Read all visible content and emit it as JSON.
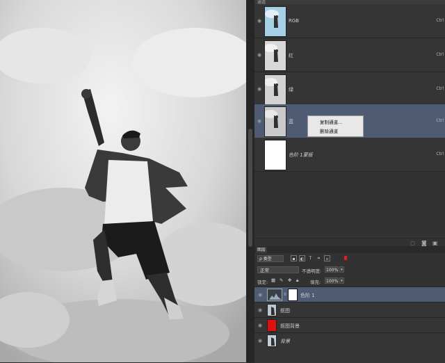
{
  "channels": {
    "header_label": "通道",
    "rows": [
      {
        "name": "RGB",
        "shortcut": "Ctrl"
      },
      {
        "name": "红",
        "shortcut": "Ctrl"
      },
      {
        "name": "绿",
        "shortcut": "Ctrl"
      },
      {
        "name": "蓝",
        "shortcut": "Ctrl"
      },
      {
        "name": "色阶 1蒙版",
        "shortcut": "Ctrl"
      }
    ]
  },
  "context_menu": {
    "items": [
      "复制通道...",
      "删除通道"
    ]
  },
  "layers": {
    "tab_label": "图层",
    "filter_label": "ρ 类型",
    "blend_mode": "正常",
    "opacity_label": "不透明度:",
    "opacity_value": "100%",
    "lock_label": "锁定:",
    "fill_label": "填充:",
    "fill_value": "100%",
    "rows": [
      {
        "name": "色阶 1",
        "selected": true
      },
      {
        "name": "抠图"
      },
      {
        "name": "抠图背景"
      },
      {
        "name": "背景"
      }
    ]
  },
  "colors": {
    "accent_selected": "#4f5a73",
    "red_fill": "#e01010"
  }
}
